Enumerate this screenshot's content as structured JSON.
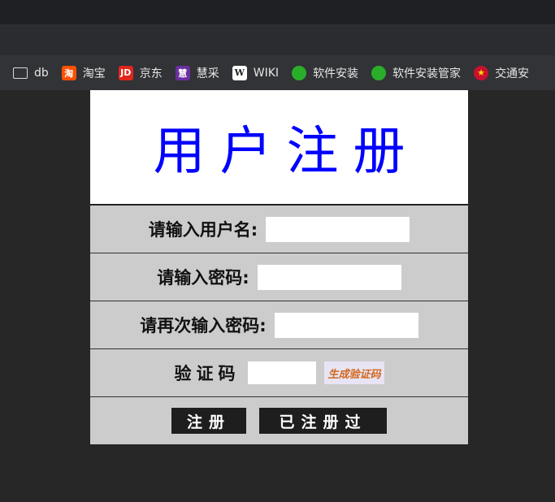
{
  "bookmarks": [
    {
      "label": "db",
      "icon": "folder-icon",
      "glyph": ""
    },
    {
      "label": "淘宝",
      "icon": "taobao-icon",
      "glyph": "淘"
    },
    {
      "label": "京东",
      "icon": "jd-icon",
      "glyph": "JD"
    },
    {
      "label": "慧采",
      "icon": "huicai-icon",
      "glyph": "慧"
    },
    {
      "label": "WIKI",
      "icon": "wiki-icon",
      "glyph": "W"
    },
    {
      "label": "软件安装",
      "icon": "wechat-icon",
      "glyph": ""
    },
    {
      "label": "软件安装管家",
      "icon": "wechat-icon",
      "glyph": ""
    },
    {
      "label": "交通安",
      "icon": "police-badge-icon",
      "glyph": "★"
    }
  ],
  "form": {
    "title": "用户注册",
    "username_label": "请输入用户名:",
    "username_value": "",
    "password_label": "请输入密码:",
    "password_value": "",
    "confirm_label": "请再次输入密码:",
    "confirm_value": "",
    "captcha_label": "验证码",
    "captcha_value": "",
    "captcha_button": "生成验证码",
    "register_button": "注册",
    "registered_button": "已注册过"
  },
  "colors": {
    "title": "#0000ff",
    "page_bg": "#272727",
    "row_bg": "#cccccc",
    "button_bg": "#1e1e1e",
    "captcha_text": "#d2691e"
  }
}
